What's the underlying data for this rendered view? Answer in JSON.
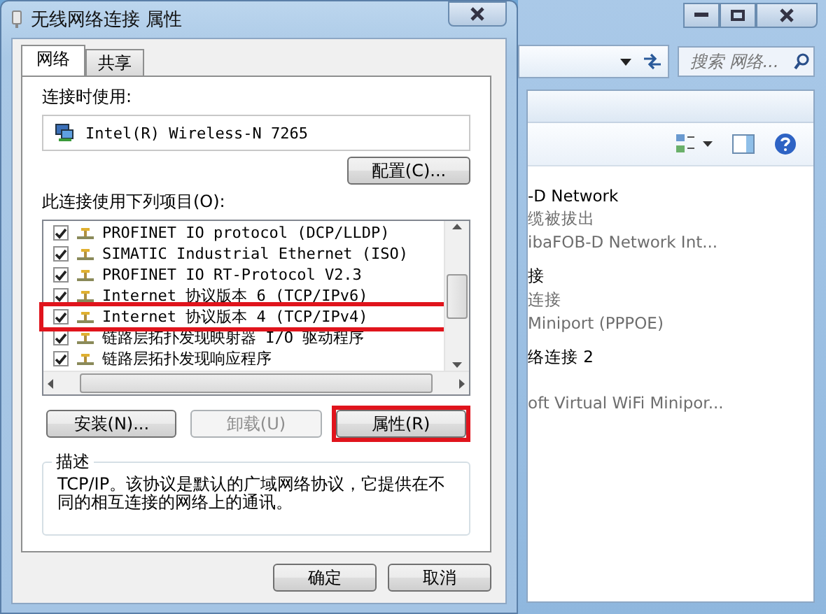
{
  "dialog": {
    "title": "无线网络连接 属性",
    "tabs": [
      {
        "label": "网络",
        "selected": true
      },
      {
        "label": "共享",
        "selected": false
      }
    ],
    "connect_using_label": "连接时使用:",
    "adapter": "Intel(R) Wireless-N 7265",
    "configure_button": "配置(C)...",
    "items_label": "此连接使用下列项目(O):",
    "items": [
      {
        "label": "PROFINET IO protocol (DCP/LLDP)",
        "checked": true,
        "highlighted": false
      },
      {
        "label": "SIMATIC Industrial Ethernet (ISO)",
        "checked": true,
        "highlighted": false
      },
      {
        "label": "PROFINET IO RT-Protocol V2.3",
        "checked": true,
        "highlighted": false
      },
      {
        "label": "Internet 协议版本 6 (TCP/IPv6)",
        "checked": true,
        "highlighted": false
      },
      {
        "label": "Internet 协议版本 4 (TCP/IPv4)",
        "checked": true,
        "highlighted": true
      },
      {
        "label": "链路层拓扑发现映射器 I/O 驱动程序",
        "checked": true,
        "highlighted": false
      },
      {
        "label": "链路层拓扑发现响应程序",
        "checked": true,
        "highlighted": false
      }
    ],
    "item_buttons": [
      {
        "label": "安装(N)...",
        "disabled": false,
        "highlighted": false
      },
      {
        "label": "卸载(U)",
        "disabled": true,
        "highlighted": false
      },
      {
        "label": "属性(R)",
        "disabled": false,
        "highlighted": true
      }
    ],
    "description_label": "描述",
    "description": "TCP/IP。该协议是默认的广域网络协议，它提供在不同的相互连接的网络上的通讯。",
    "buttons": [
      "确定",
      "取消"
    ]
  },
  "background_window": {
    "search": {
      "placeholder": "搜索 网络..."
    },
    "connections": [
      {
        "name": "-D Network",
        "status": "缆被拔出",
        "device": "ibaFOB-D Network Int..."
      },
      {
        "name": "接",
        "status": "连接",
        "device": "Miniport (PPPOE)"
      },
      {
        "name": "络连接 2",
        "device": "oft Virtual WiFi Minipor..."
      }
    ]
  }
}
